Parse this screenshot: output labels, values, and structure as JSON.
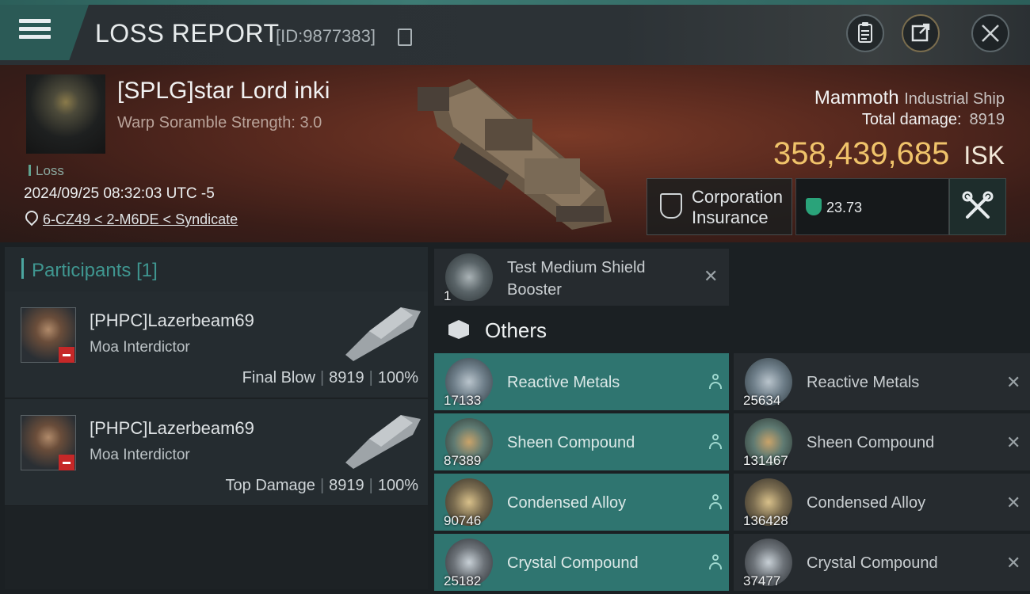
{
  "header": {
    "title": "LOSS REPORT",
    "report_id": "[ID:9877383]",
    "icons": [
      "menu-icon",
      "copy-icon",
      "clipboard-icon",
      "share-icon",
      "close-icon"
    ]
  },
  "victim": {
    "name": "[SPLG]star Lord inki",
    "warp_scramble": "Warp Soramble Strength: 3.0",
    "loss_label": "Loss",
    "timestamp": "2024/09/25 08:32:03 UTC -5",
    "location": "6-CZ49 < 2-M6DE < Syndicate",
    "ship_name": "Mammoth",
    "ship_class": "Industrial Ship",
    "total_damage_label": "Total damage:",
    "total_damage": "8919",
    "isk_value": "358,439,685",
    "isk_unit": "ISK",
    "insurance_label_1": "Corporation",
    "insurance_label_2": "Insurance",
    "insurance_value": "23.73"
  },
  "participants": {
    "title": "Participants",
    "count": "[1]",
    "rows": [
      {
        "name": "[PHPC]Lazerbeam69",
        "ship": "Moa Interdictor",
        "role": "Final Blow",
        "damage": "8919",
        "percent": "100%"
      },
      {
        "name": "[PHPC]Lazerbeam69",
        "ship": "Moa Interdictor",
        "role": "Top Damage",
        "damage": "8919",
        "percent": "100%"
      }
    ]
  },
  "module": {
    "name_1": "Test Medium Shield",
    "name_2": "Booster",
    "qty": "1"
  },
  "others": {
    "title": "Others",
    "items": [
      {
        "name": "Reactive Metals",
        "dropped_qty": "17133",
        "destroyed_name": "Reactive Metals",
        "destroyed_qty": "25634"
      },
      {
        "name": "Sheen Compound",
        "dropped_qty": "87389",
        "destroyed_name": "Sheen Compound",
        "destroyed_qty": "131467"
      },
      {
        "name": "Condensed Alloy",
        "dropped_qty": "90746",
        "destroyed_name": "Condensed Alloy",
        "destroyed_qty": "136428"
      },
      {
        "name": "Crystal Compound",
        "dropped_qty": "25182",
        "destroyed_name": "Crystal Compound",
        "destroyed_qty": "37477"
      }
    ]
  },
  "colors": {
    "accent": "#2f7570",
    "isk": "#f0c36a",
    "danger": "#c62828",
    "insurance": "#2aa37a"
  }
}
